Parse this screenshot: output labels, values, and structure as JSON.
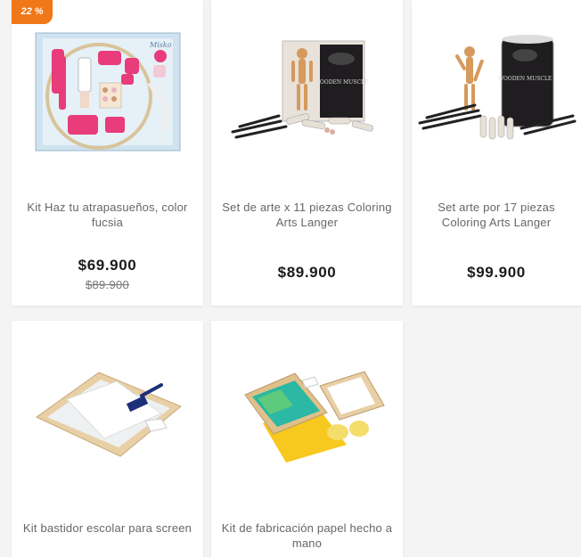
{
  "badge": {
    "discount": "22 %"
  },
  "products": [
    {
      "title": "Kit Haz tu atrapasueños, color fucsia",
      "price": "$69.900",
      "old_price": "$89.900"
    },
    {
      "title": "Set de arte x 11 piezas Coloring Arts Langer",
      "price": "$89.900"
    },
    {
      "title": "Set arte por 17 piezas Coloring Arts Langer",
      "price": "$99.900"
    },
    {
      "title": "Kit bastidor escolar para screen"
    },
    {
      "title": "Kit de fabricación papel hecho a mano"
    }
  ],
  "image_text": {
    "brand_misko": "Misko",
    "wooden_muscle": "WOODEN MUSCLE"
  }
}
